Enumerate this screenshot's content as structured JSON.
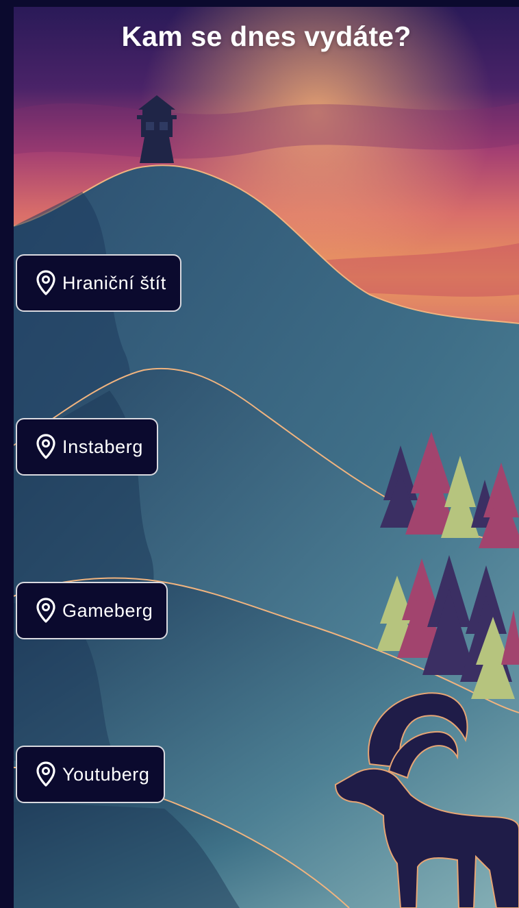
{
  "header": {
    "title": "Kam se dnes vydáte?"
  },
  "locations": [
    {
      "label": "Hraniční štít",
      "icon": "map-pin-icon"
    },
    {
      "label": "Instaberg",
      "icon": "map-pin-icon"
    },
    {
      "label": "Gameberg",
      "icon": "map-pin-icon"
    },
    {
      "label": "Youtuberg",
      "icon": "map-pin-icon"
    }
  ],
  "colors": {
    "background": "#0b0a2e",
    "sky_top": "#2a1a58",
    "sky_glow": "#e9975e",
    "hill": "#2f5a78",
    "hill_outline": "#f1b47f",
    "button_bg": "#0b0a2e",
    "button_border": "#ffffff"
  }
}
